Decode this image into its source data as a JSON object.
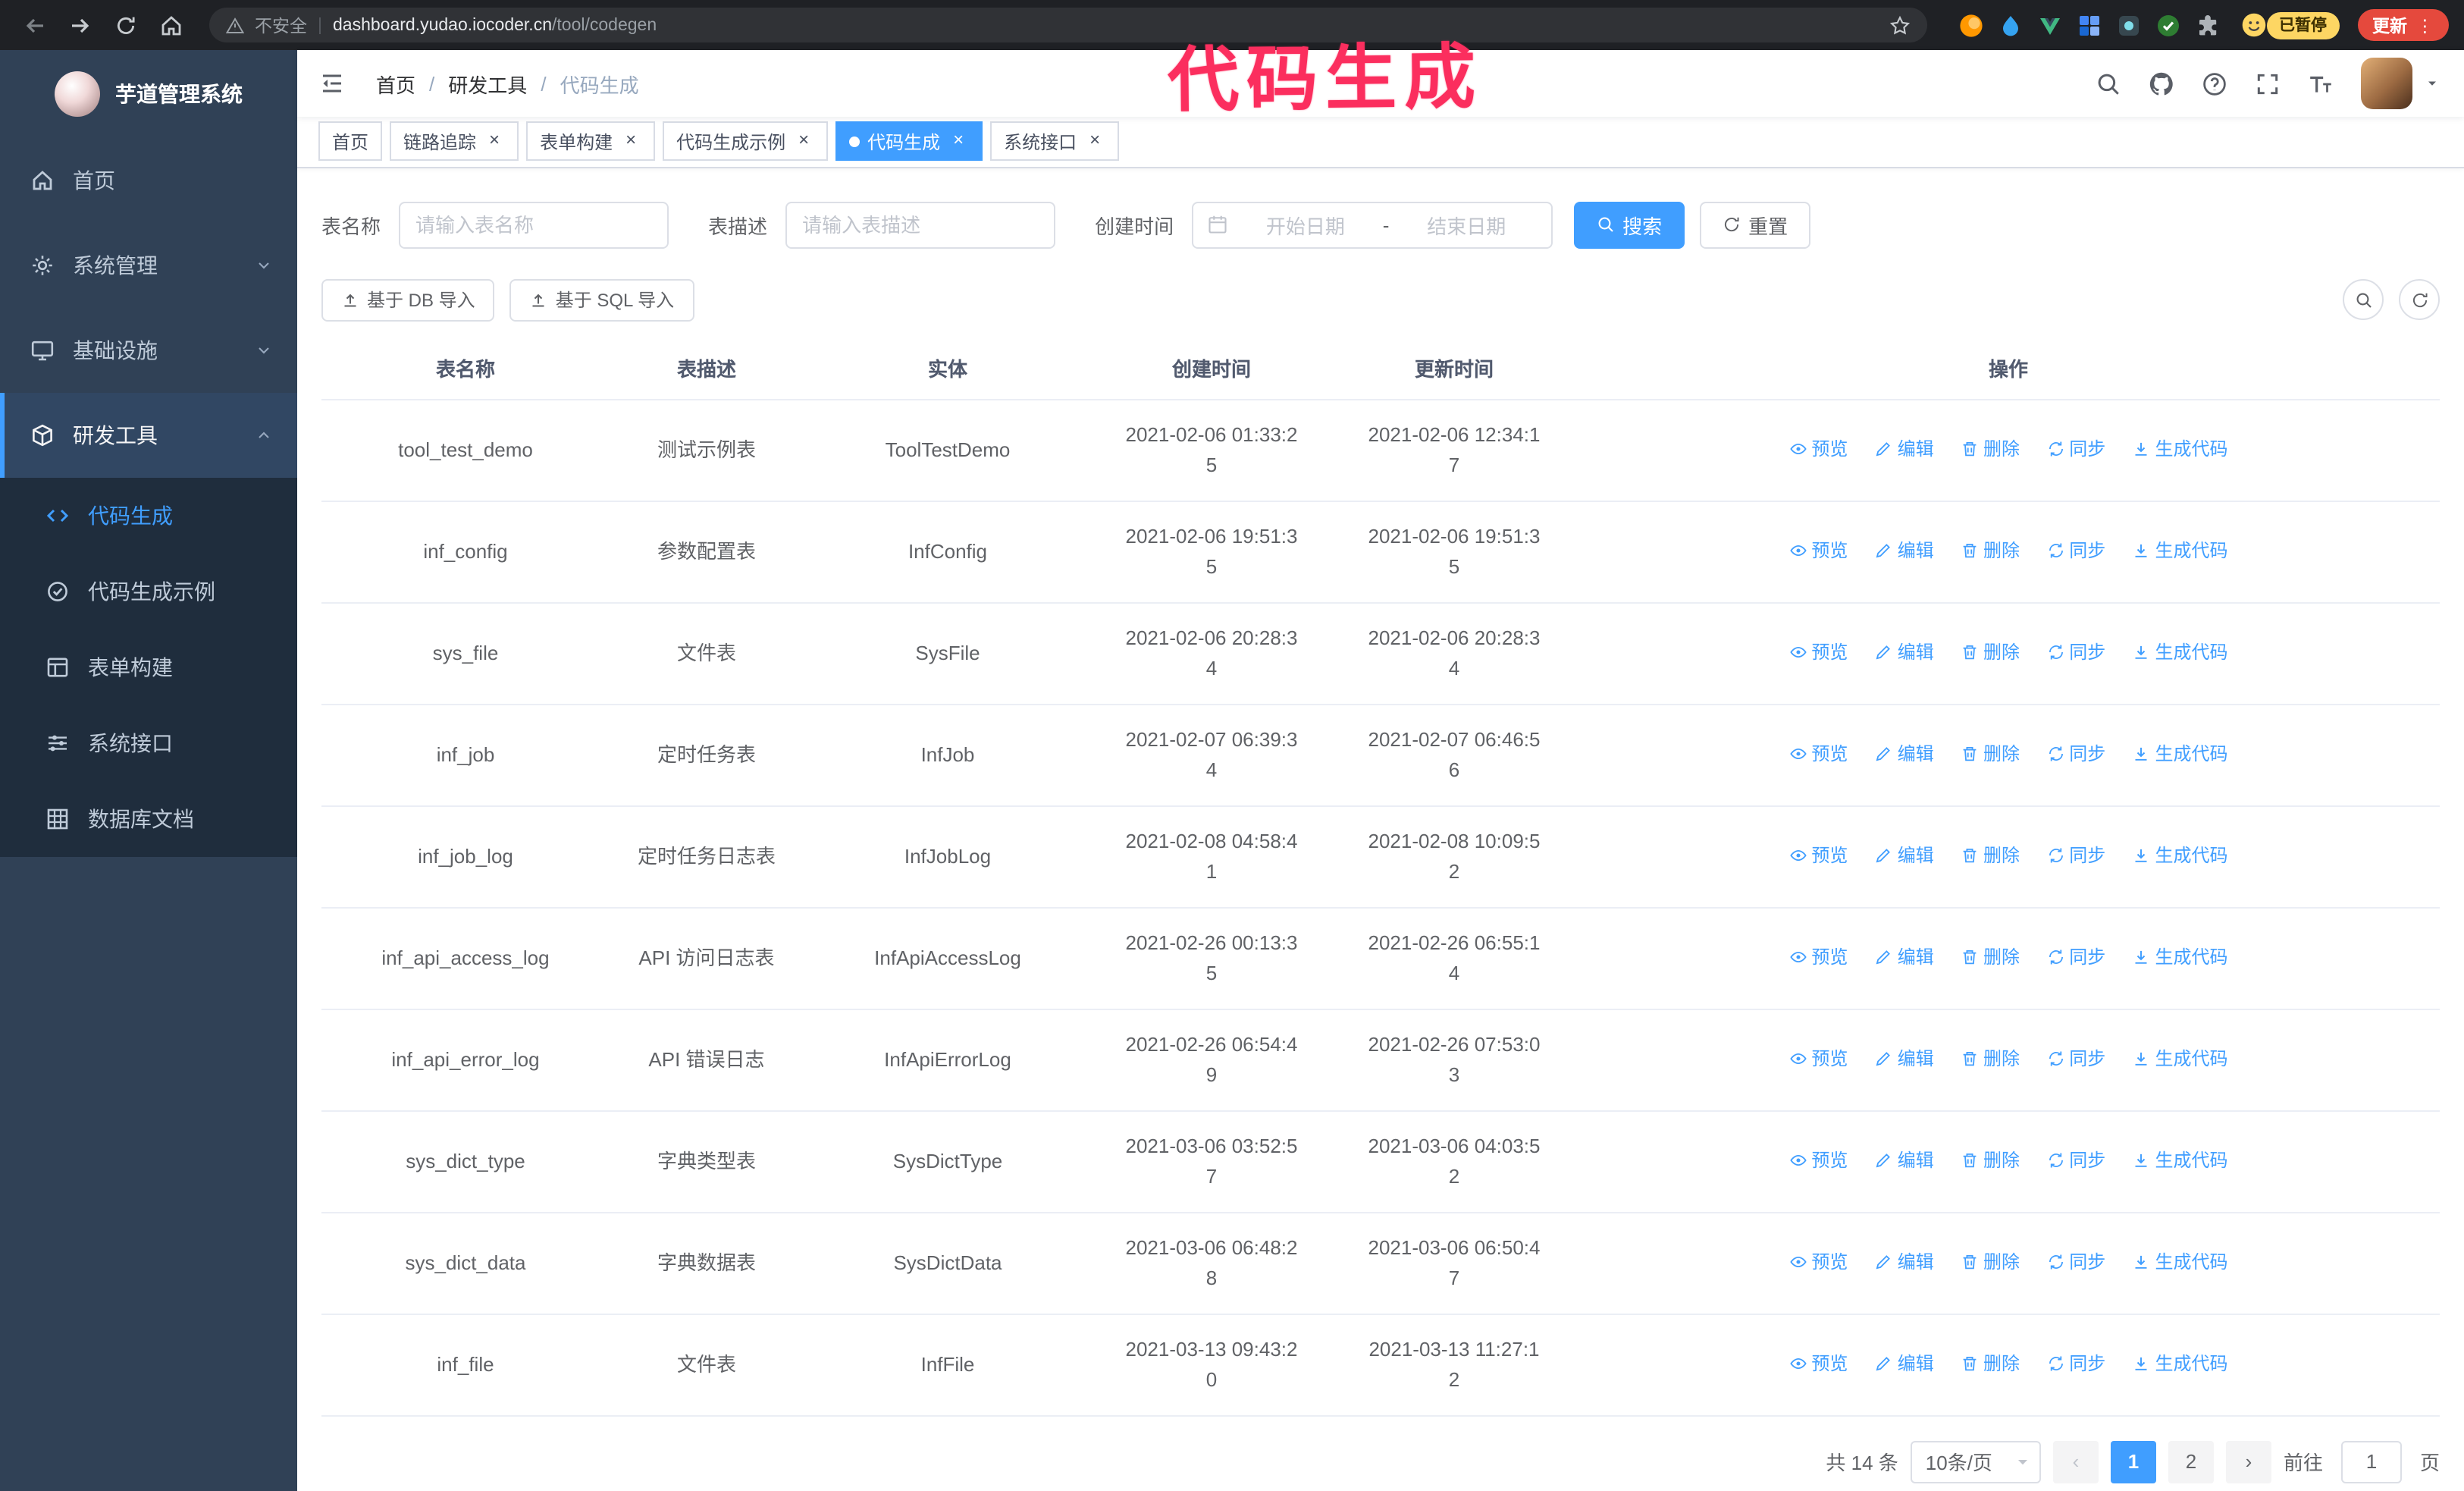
{
  "colors": {
    "accent": "#409eff",
    "annotation": "#fb2e5e",
    "update": "#e5493d",
    "paused": "#fdd663",
    "sidebar": "#304156",
    "submenu": "#1f2d3d",
    "chrome-bg": "#1f2125"
  },
  "annotation": {
    "text": "代码生成"
  },
  "browser": {
    "security_label": "不安全",
    "divider": "|",
    "url_host": "dashboard.yudao.iocoder.cn",
    "url_path": "/tool/codegen",
    "paused_badge": "已暂停",
    "update_button": "更新",
    "kebab": "⋮",
    "extension_icons": [
      "orange-extension-icon",
      "drop-extension-icon",
      "vue-devtools-extension-icon",
      "grid-extension-icon",
      "dark-extension-icon",
      "green-check-extension-icon",
      "extensions-puzzle-icon"
    ]
  },
  "sidebar": {
    "logo_title": "芋道管理系统",
    "items": [
      {
        "label": "首页",
        "icon": "home-icon"
      },
      {
        "label": "系统管理",
        "icon": "gear-icon"
      },
      {
        "label": "基础设施",
        "icon": "monitor-icon"
      },
      {
        "label": "研发工具",
        "icon": "cube-icon"
      }
    ],
    "subitems": [
      {
        "label": "代码生成",
        "icon": "code-icon",
        "active": true
      },
      {
        "label": "代码生成示例",
        "icon": "badge-icon",
        "active": false
      },
      {
        "label": "表单构建",
        "icon": "form-icon",
        "active": false
      },
      {
        "label": "系统接口",
        "icon": "sliders-icon",
        "active": false
      },
      {
        "label": "数据库文档",
        "icon": "grid-doc-icon",
        "active": false
      }
    ]
  },
  "navbar": {
    "breadcrumb": [
      "首页",
      "研发工具",
      "代码生成"
    ],
    "separator": "/",
    "right_icons": [
      "search-icon",
      "github-icon",
      "help-icon",
      "fullscreen-icon",
      "font-size-icon",
      "avatar",
      "caret-down-icon"
    ]
  },
  "tabs": [
    {
      "label": "首页",
      "closable": false,
      "active": false
    },
    {
      "label": "链路追踪",
      "closable": true,
      "active": false
    },
    {
      "label": "表单构建",
      "closable": true,
      "active": false
    },
    {
      "label": "代码生成示例",
      "closable": true,
      "active": false
    },
    {
      "label": "代码生成",
      "closable": true,
      "active": true
    },
    {
      "label": "系统接口",
      "closable": true,
      "active": false
    }
  ],
  "filter": {
    "name_label": "表名称",
    "name_placeholder": "请输入表名称",
    "desc_label": "表描述",
    "desc_placeholder": "请输入表描述",
    "time_label": "创建时间",
    "start_placeholder": "开始日期",
    "range_separator": "-",
    "end_placeholder": "结束日期",
    "search_button": "搜索",
    "reset_button": "重置"
  },
  "toolbar": {
    "import_db_button": "基于 DB 导入",
    "import_sql_button": "基于 SQL 导入"
  },
  "table": {
    "columns": [
      "表名称",
      "表描述",
      "实体",
      "创建时间",
      "更新时间",
      "操作"
    ],
    "actions": [
      "预览",
      "编辑",
      "删除",
      "同步",
      "生成代码"
    ],
    "rows": [
      {
        "name": "tool_test_demo",
        "desc": "测试示例表",
        "entity": "ToolTestDemo",
        "created": "2021-02-06 01:33:25",
        "updated": "2021-02-06 12:34:17"
      },
      {
        "name": "inf_config",
        "desc": "参数配置表",
        "entity": "InfConfig",
        "created": "2021-02-06 19:51:35",
        "updated": "2021-02-06 19:51:35"
      },
      {
        "name": "sys_file",
        "desc": "文件表",
        "entity": "SysFile",
        "created": "2021-02-06 20:28:34",
        "updated": "2021-02-06 20:28:34"
      },
      {
        "name": "inf_job",
        "desc": "定时任务表",
        "entity": "InfJob",
        "created": "2021-02-07 06:39:34",
        "updated": "2021-02-07 06:46:56"
      },
      {
        "name": "inf_job_log",
        "desc": "定时任务日志表",
        "entity": "InfJobLog",
        "created": "2021-02-08 04:58:41",
        "updated": "2021-02-08 10:09:52"
      },
      {
        "name": "inf_api_access_log",
        "desc": "API 访问日志表",
        "entity": "InfApiAccessLog",
        "created": "2021-02-26 00:13:35",
        "updated": "2021-02-26 06:55:14"
      },
      {
        "name": "inf_api_error_log",
        "desc": "API 错误日志",
        "entity": "InfApiErrorLog",
        "created": "2021-02-26 06:54:49",
        "updated": "2021-02-26 07:53:03"
      },
      {
        "name": "sys_dict_type",
        "desc": "字典类型表",
        "entity": "SysDictType",
        "created": "2021-03-06 03:52:57",
        "updated": "2021-03-06 04:03:52"
      },
      {
        "name": "sys_dict_data",
        "desc": "字典数据表",
        "entity": "SysDictData",
        "created": "2021-03-06 06:48:28",
        "updated": "2021-03-06 06:50:47"
      },
      {
        "name": "inf_file",
        "desc": "文件表",
        "entity": "InfFile",
        "created": "2021-03-13 09:43:20",
        "updated": "2021-03-13 11:27:12"
      }
    ]
  },
  "pagination": {
    "total_text": "共 14 条",
    "page_size": "10条/页",
    "pages": [
      "1",
      "2"
    ],
    "active_page": "1",
    "goto_label": "前往",
    "goto_value": "1",
    "goto_unit": "页"
  },
  "ui": {
    "close_glyph": "×",
    "prev_glyph": "‹",
    "next_glyph": "›"
  }
}
